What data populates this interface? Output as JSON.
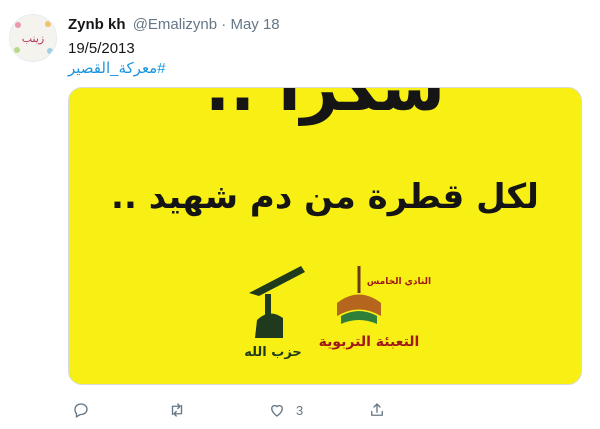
{
  "tweet": {
    "user_name": "Zynb kh",
    "handle": "@Emalizynb",
    "separator": "·",
    "date": "May 18",
    "text_date": "19/5/2013",
    "hashtag": "#معركة_القصير"
  },
  "avatar": {
    "label": "زينب"
  },
  "media": {
    "headline": "شكراً ..",
    "line": "لكل قطرة من دم شهيد ..",
    "logo_right_label": "النادي الخامس",
    "logo_right_caption": "التعبئة التربوية",
    "logo_left_label": "حزب الله",
    "background": "#f8f015"
  },
  "actions": {
    "reply_icon": "reply-icon",
    "retweet_icon": "retweet-icon",
    "like_icon": "heart-icon",
    "like_count": "3",
    "share_icon": "share-icon"
  },
  "colors": {
    "accent": "#1b95e0",
    "muted": "#657786"
  }
}
